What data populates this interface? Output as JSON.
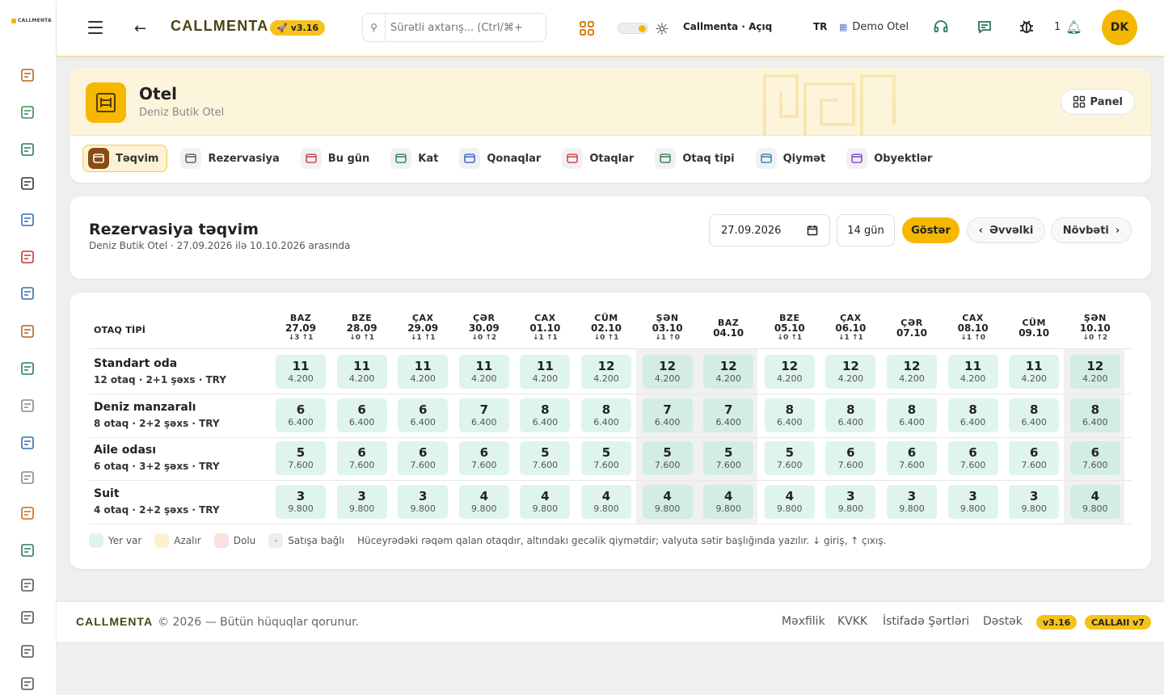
{
  "app": {
    "brand": "CALLMENTA",
    "brand_mini": "CALLMENTA",
    "version": "v3.16",
    "search_placeholder": "Sürətli axtarış... (Ctrl/⌘+",
    "status_text": "Callmenta · Açıq",
    "lang": "TR",
    "hotel_name": "Demo Otel",
    "notif_count": "1",
    "avatar": "DK",
    "accent": "#f5b800"
  },
  "sidebar_icons": [
    "calendar-grid-icon",
    "clipboard-icon",
    "id-card-icon",
    "brackets-icon",
    "user-circle-icon",
    "alarm-icon",
    "chat-user-icon",
    "medal-icon",
    "megaphone-icon",
    "gear-icon",
    "table-icon",
    "shield-icon",
    "buildings-icon",
    "chart-line-icon",
    "globe-icon",
    "filter-icon",
    "report-icon",
    "warning-icon"
  ],
  "module": {
    "title": "Otel",
    "subtitle": "Deniz Butik Otel",
    "panel_label": "Panel"
  },
  "tabs": [
    {
      "label": "Təqvim",
      "icon": "calendar-icon",
      "color": "#8b4a12"
    },
    {
      "label": "Rezervasiya",
      "icon": "ticket-icon",
      "color": "#666"
    },
    {
      "label": "Bu gün",
      "icon": "bell-service-icon",
      "color": "#d04a4a"
    },
    {
      "label": "Kat",
      "icon": "broom-icon",
      "color": "#3b8a5a"
    },
    {
      "label": "Qonaqlar",
      "icon": "guest-icon",
      "color": "#4a6ad0"
    },
    {
      "label": "Otaqlar",
      "icon": "key-icon",
      "color": "#d04a4a"
    },
    {
      "label": "Otaq tipi",
      "icon": "bed-icon",
      "color": "#3b8a5a"
    },
    {
      "label": "Qiymət",
      "icon": "tag-icon",
      "color": "#3a8aa8"
    },
    {
      "label": "Obyektlər",
      "icon": "object-icon",
      "color": "#8a4ad0"
    }
  ],
  "calendar": {
    "title": "Rezervasiya təqvim",
    "subtitle": "Deniz Butik Otel · 27.09.2026 ilə 10.10.2026 arasında",
    "start_date": "27.09.2026",
    "days": "14 gün",
    "show_label": "Göstər",
    "prev_label": "Əvvəlki",
    "next_label": "Növbəti",
    "room_type_header": "OTAQ TİPİ",
    "dates": [
      {
        "day": "BAZ",
        "date": "27.09",
        "io": "↓3 ↑1",
        "weekend": false
      },
      {
        "day": "BZE",
        "date": "28.09",
        "io": "↓0 ↑1",
        "weekend": false
      },
      {
        "day": "ÇAX",
        "date": "29.09",
        "io": "↓1 ↑1",
        "weekend": false
      },
      {
        "day": "ÇƏR",
        "date": "30.09",
        "io": "↓0 ↑2",
        "weekend": false
      },
      {
        "day": "CAX",
        "date": "01.10",
        "io": "↓1 ↑1",
        "weekend": false
      },
      {
        "day": "CÜM",
        "date": "02.10",
        "io": "↓0 ↑1",
        "weekend": false
      },
      {
        "day": "ŞƏN",
        "date": "03.10",
        "io": "↓1 ↑0",
        "weekend": true
      },
      {
        "day": "BAZ",
        "date": "04.10",
        "io": "",
        "weekend": true
      },
      {
        "day": "BZE",
        "date": "05.10",
        "io": "↓0 ↑1",
        "weekend": false
      },
      {
        "day": "ÇAX",
        "date": "06.10",
        "io": "↓1 ↑1",
        "weekend": false
      },
      {
        "day": "ÇƏR",
        "date": "07.10",
        "io": "",
        "weekend": false
      },
      {
        "day": "CAX",
        "date": "08.10",
        "io": "↓1 ↑0",
        "weekend": false
      },
      {
        "day": "CÜM",
        "date": "09.10",
        "io": "",
        "weekend": false
      },
      {
        "day": "ŞƏN",
        "date": "10.10",
        "io": "↓0 ↑2",
        "weekend": true
      }
    ],
    "rooms": [
      {
        "name": "Standart oda",
        "info": "12 otaq · 2+1 şəxs · TRY",
        "price": "4.200",
        "avail": [
          11,
          11,
          11,
          11,
          11,
          12,
          12,
          12,
          12,
          12,
          12,
          11,
          11,
          12
        ]
      },
      {
        "name": "Deniz manzaralı",
        "info": "8 otaq · 2+2 şəxs · TRY",
        "price": "6.400",
        "avail": [
          6,
          6,
          6,
          7,
          8,
          8,
          7,
          7,
          8,
          8,
          8,
          8,
          8,
          8
        ]
      },
      {
        "name": "Aile odası",
        "info": "6 otaq · 3+2 şəxs · TRY",
        "price": "7.600",
        "avail": [
          5,
          6,
          6,
          6,
          5,
          5,
          5,
          5,
          5,
          6,
          6,
          6,
          6,
          6
        ]
      },
      {
        "name": "Suit",
        "info": "4 otaq · 2+2 şəxs · TRY",
        "price": "9.800",
        "avail": [
          3,
          3,
          3,
          4,
          4,
          4,
          4,
          4,
          4,
          3,
          3,
          3,
          3,
          4
        ]
      }
    ],
    "legend": [
      {
        "label": "Yer var",
        "color": "#dff5ec",
        "mark": ""
      },
      {
        "label": "Azalır",
        "color": "#fdf0cf",
        "mark": ""
      },
      {
        "label": "Dolu",
        "color": "#fbe0e0",
        "mark": ""
      },
      {
        "label": "Satışa bağlı",
        "color": "#eeeeee",
        "mark": "-"
      }
    ],
    "legend_note": "Hüceyrədəki rəqəm qalan otaqdır, altındakı gecəlik qiymətdir; valyuta sətir başlığında yazılır. ↓ giriş, ↑ çıxış."
  },
  "footer": {
    "brand": "CALLMENTA",
    "copyright": "© 2026 — Bütün hüquqlar qorunur.",
    "links": [
      "Məxfilik",
      "KVKK",
      "İstifadə Şərtləri",
      "Dəstək"
    ],
    "badges": [
      "v3.16",
      "CALLAII v7"
    ]
  }
}
